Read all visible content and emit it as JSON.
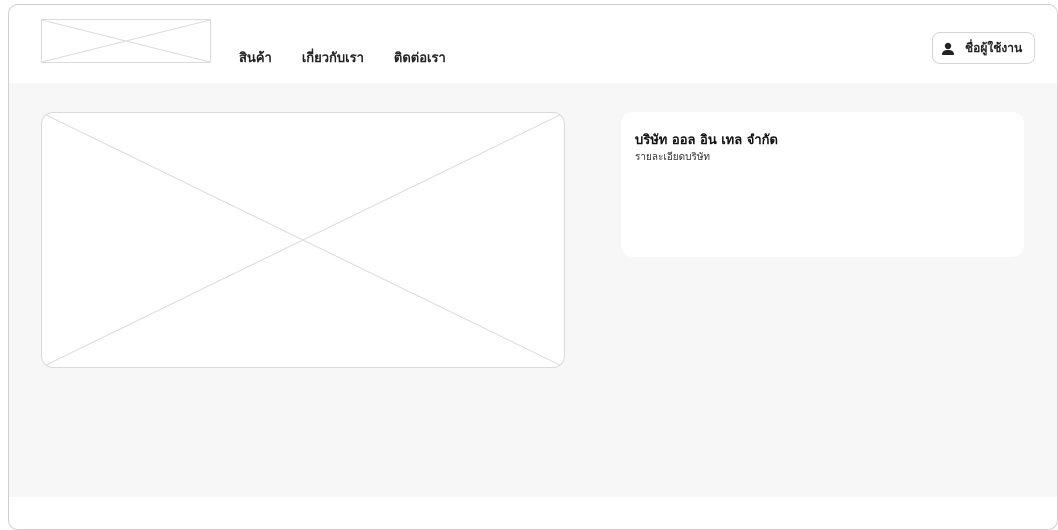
{
  "header": {
    "nav": [
      {
        "label": "สินค้า"
      },
      {
        "label": "เกี่ยวกับเรา"
      },
      {
        "label": "ติดต่อเรา"
      }
    ],
    "user_button": {
      "label": "ชื่อผู้ใช้งาน",
      "icon": "user-icon"
    }
  },
  "company_card": {
    "title": "บริษัท ออล อิน เทล จำกัด",
    "description": "รายละเอียดบริษัท"
  },
  "colors": {
    "page_background": "#f7f7f7",
    "card_background": "#ffffff",
    "border": "#dadada"
  }
}
